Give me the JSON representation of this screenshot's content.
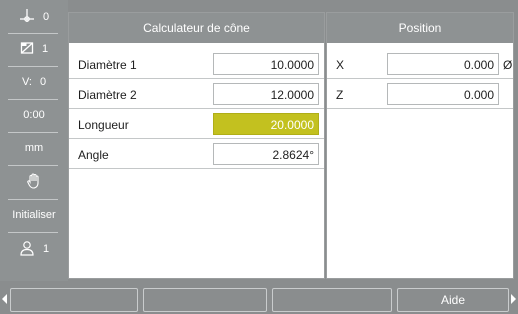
{
  "sidebar": {
    "axis_count": "0",
    "tool_number": "1",
    "v_label": "V:",
    "v_value": "0",
    "time": "0:00",
    "unit": "mm",
    "initialize_label": "Initialiser",
    "user_number": "1"
  },
  "calculator": {
    "title": "Calculateur de cône",
    "rows": [
      {
        "label": "Diamètre 1",
        "value": "10.0000"
      },
      {
        "label": "Diamètre 2",
        "value": "12.0000"
      },
      {
        "label": "Longueur",
        "value": "20.0000"
      },
      {
        "label": "Angle",
        "value": "2.8624°"
      }
    ]
  },
  "position": {
    "title": "Position",
    "rows": [
      {
        "axis": "X",
        "value": "0.000",
        "suffix": "Ø"
      },
      {
        "axis": "Z",
        "value": "0.000",
        "suffix": ""
      }
    ]
  },
  "softkeys": [
    "",
    "",
    "",
    "Aide"
  ],
  "colors": {
    "active_field": "#c3c11f",
    "header": "#8e9293"
  }
}
